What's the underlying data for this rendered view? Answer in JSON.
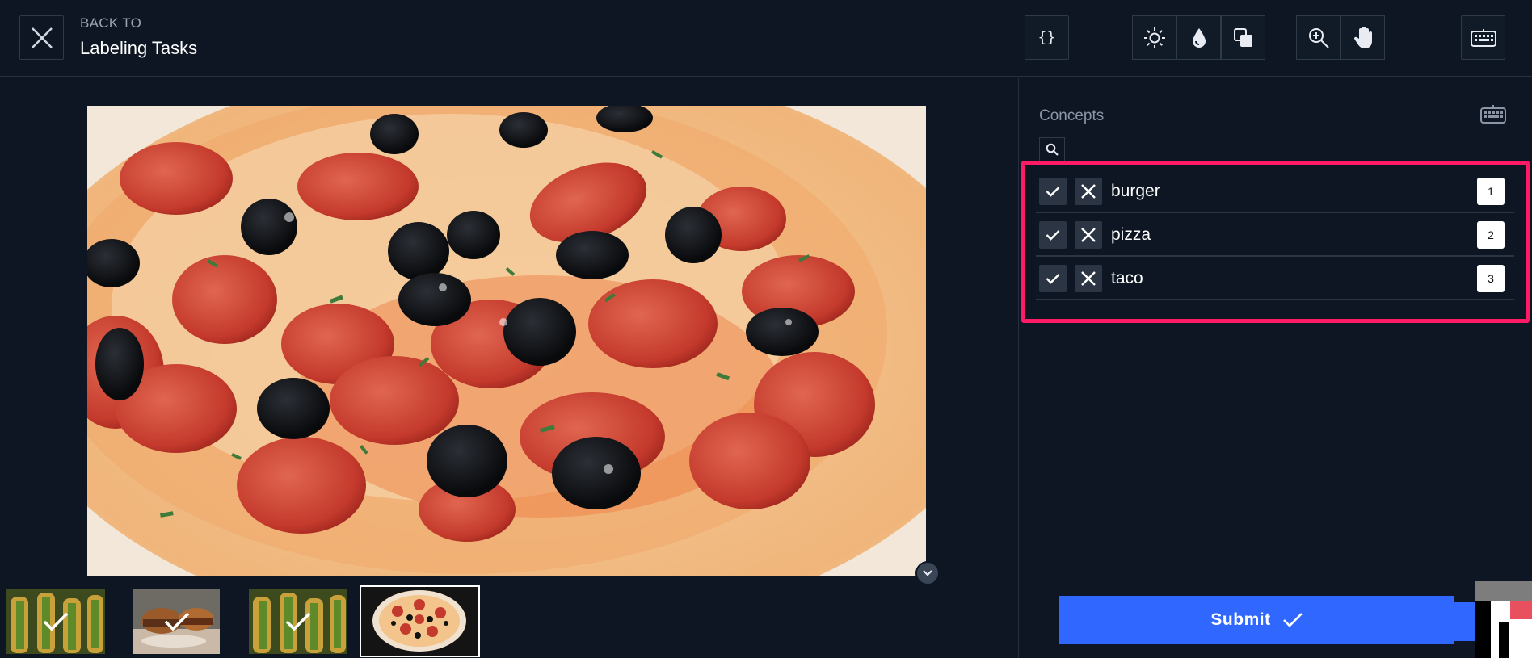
{
  "header": {
    "back_to_label": "BACK TO",
    "back_title": "Labeling Tasks",
    "json_button_label": "{}",
    "icons": [
      "close-icon",
      "sun-icon",
      "drop-icon",
      "contrast-icon",
      "zoom-in-icon",
      "hand-icon",
      "keyboard-icon"
    ]
  },
  "sidebar": {
    "title": "Concepts",
    "concepts": [
      {
        "label": "burger",
        "hotkey": "1"
      },
      {
        "label": "pizza",
        "hotkey": "2"
      },
      {
        "label": "taco",
        "hotkey": "3"
      }
    ]
  },
  "thumbnails": [
    {
      "subject": "tacos",
      "labeled": true,
      "active": false
    },
    {
      "subject": "burgers",
      "labeled": true,
      "active": false
    },
    {
      "subject": "tacos",
      "labeled": true,
      "active": false
    },
    {
      "subject": "pizza",
      "labeled": false,
      "active": true
    }
  ],
  "footer": {
    "submit_label": "Submit"
  },
  "colors": {
    "background": "#0e1623",
    "accent": "#2f67ff",
    "highlight": "#ff1a66"
  }
}
